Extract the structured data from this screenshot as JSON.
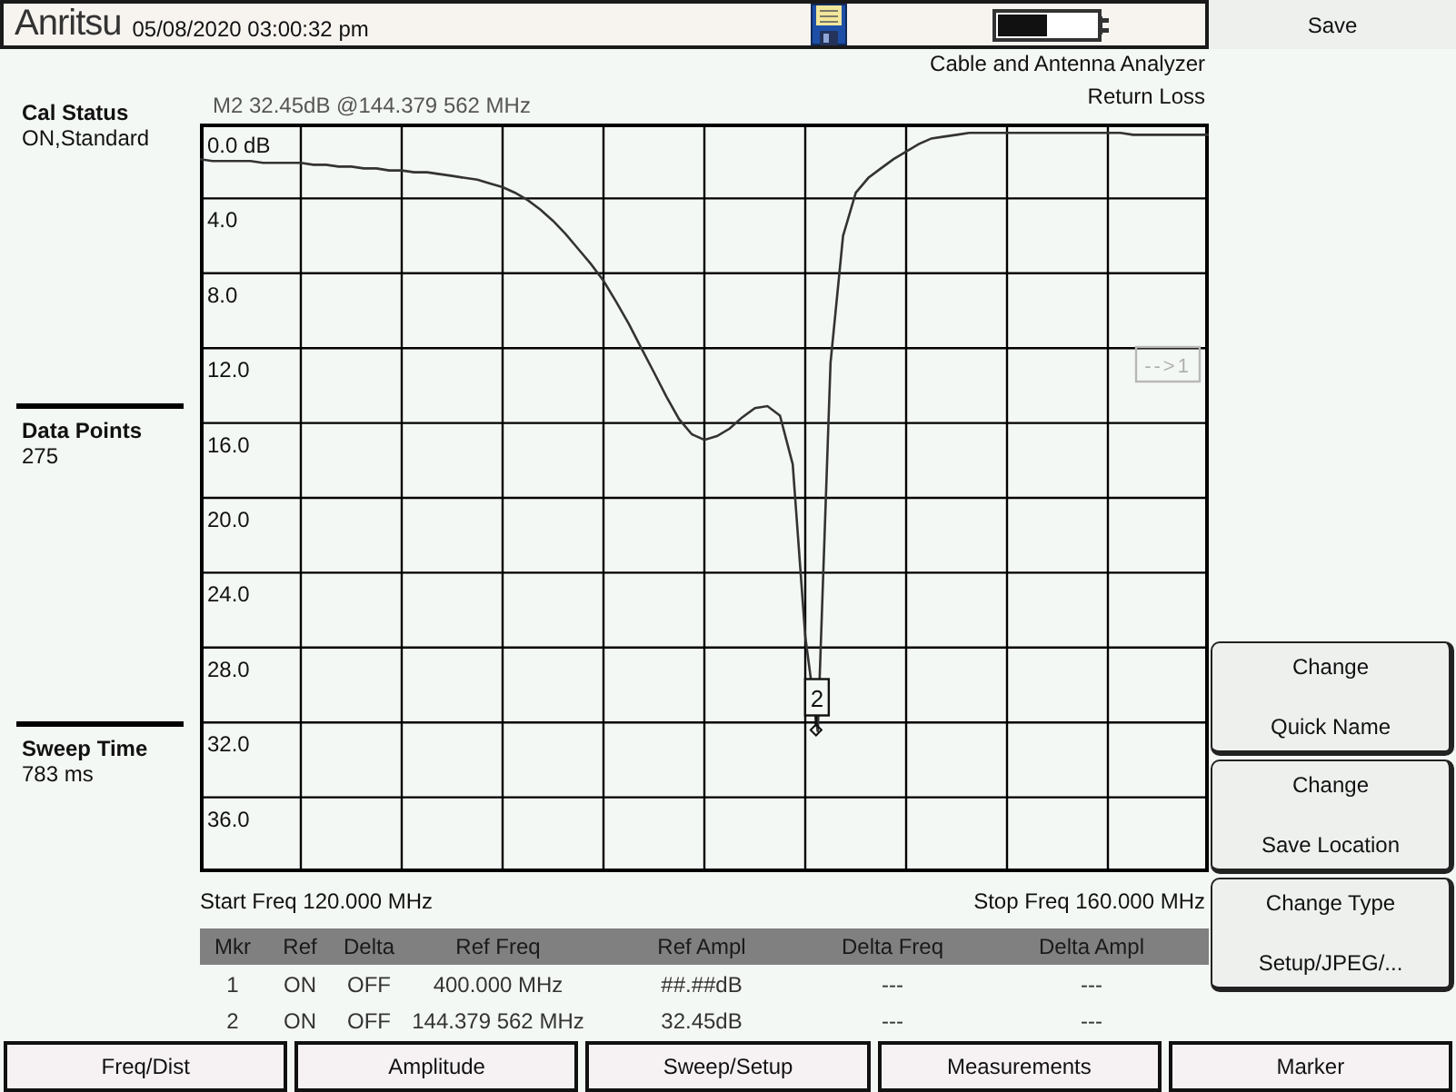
{
  "status_bar": {
    "logo": "Anritsu",
    "datetime": "05/08/2020 03:00:32 pm"
  },
  "analyzer": {
    "mode": "Cable and Antenna Analyzer",
    "measurement": "Return Loss",
    "marker_readout": "M2 32.45dB @144.379 562 MHz"
  },
  "side_panel": [
    {
      "label": "Cal Status",
      "value": "ON,Standard"
    },
    {
      "label": "Data Points",
      "value": "275"
    },
    {
      "label": "Sweep Time",
      "value": "783 ms"
    }
  ],
  "chart": {
    "chart_data": {
      "type": "line",
      "grid": true,
      "ylim": [
        40,
        0
      ],
      "yticks": [
        {
          "value": 0,
          "label": "0.0 dB"
        },
        {
          "value": 4,
          "label": "4.0"
        },
        {
          "value": 8,
          "label": "8.0"
        },
        {
          "value": 12,
          "label": "12.0"
        },
        {
          "value": 16,
          "label": "16.0"
        },
        {
          "value": 20,
          "label": "20.0"
        },
        {
          "value": 24,
          "label": "24.0"
        },
        {
          "value": 28,
          "label": "28.0"
        },
        {
          "value": 32,
          "label": "32.0"
        },
        {
          "value": 36,
          "label": "36.0"
        }
      ],
      "categories": [
        null,
        null,
        null,
        null,
        null,
        null,
        null,
        null,
        null,
        null,
        null,
        null,
        null,
        null,
        null,
        null,
        null,
        null,
        null,
        null,
        null,
        null,
        null,
        null,
        null,
        null,
        null,
        null,
        null,
        null,
        null,
        null,
        null,
        null,
        null,
        null,
        null,
        null,
        null,
        null,
        null,
        null,
        null,
        null,
        null,
        null,
        null,
        null,
        null,
        null,
        null,
        null,
        null,
        null,
        null,
        null,
        null,
        null,
        null,
        null,
        null,
        null,
        null,
        null,
        null,
        null,
        null,
        null,
        null,
        null,
        null,
        null,
        null,
        null,
        null,
        null,
        null,
        null,
        null,
        null,
        null
      ],
      "series": [
        {
          "color": "#333333",
          "values": [
            1.9,
            2.0,
            2.0,
            2.0,
            2.0,
            2.1,
            2.1,
            2.1,
            2.1,
            2.2,
            2.2,
            2.3,
            2.3,
            2.4,
            2.4,
            2.5,
            2.5,
            2.6,
            2.6,
            2.7,
            2.8,
            2.9,
            3.0,
            3.2,
            3.4,
            3.7,
            4.1,
            4.6,
            5.2,
            5.9,
            6.7,
            7.5,
            8.4,
            9.5,
            10.7,
            12.0,
            13.3,
            14.6,
            15.8,
            16.6,
            16.9,
            16.7,
            16.3,
            15.7,
            15.2,
            15.1,
            15.6,
            18.2,
            27.4,
            32.5,
            12.8,
            6.0,
            3.7,
            2.9,
            2.4,
            1.9,
            1.5,
            1.1,
            0.8,
            0.7,
            0.6,
            0.5,
            0.5,
            0.5,
            0.5,
            0.5,
            0.5,
            0.5,
            0.5,
            0.5,
            0.5,
            0.5,
            0.5,
            0.5,
            0.6,
            0.6,
            0.6,
            0.6,
            0.6,
            0.6,
            0.6
          ]
        }
      ]
    },
    "marker_label": "2",
    "offscreen_marker": "-->1",
    "start": "Start Freq 120.000 MHz",
    "stop": "Stop Freq 160.000 MHz"
  },
  "marker_table": {
    "columns": [
      "Mkr",
      "Ref",
      "Delta",
      "Ref Freq",
      "Ref Ampl",
      "Delta Freq",
      "Delta Ampl"
    ],
    "rows": [
      [
        "1",
        "ON",
        "OFF",
        "400.000 MHz",
        "##.##dB",
        "---",
        "---"
      ],
      [
        "2",
        "ON",
        "OFF",
        "144.379 562 MHz",
        "32.45dB",
        "---",
        "---"
      ]
    ]
  },
  "menu": {
    "title": "Save",
    "keys": [
      {
        "lines": [
          "Change",
          "Quick Name"
        ]
      },
      {
        "lines": [
          "Change",
          "Save Location"
        ]
      },
      {
        "lines": [
          "Change Type",
          "Setup/JPEG/..."
        ]
      }
    ]
  },
  "main_menu": [
    "Freq/Dist",
    "Amplitude",
    "Sweep/Setup",
    "Measurements",
    "Marker"
  ]
}
